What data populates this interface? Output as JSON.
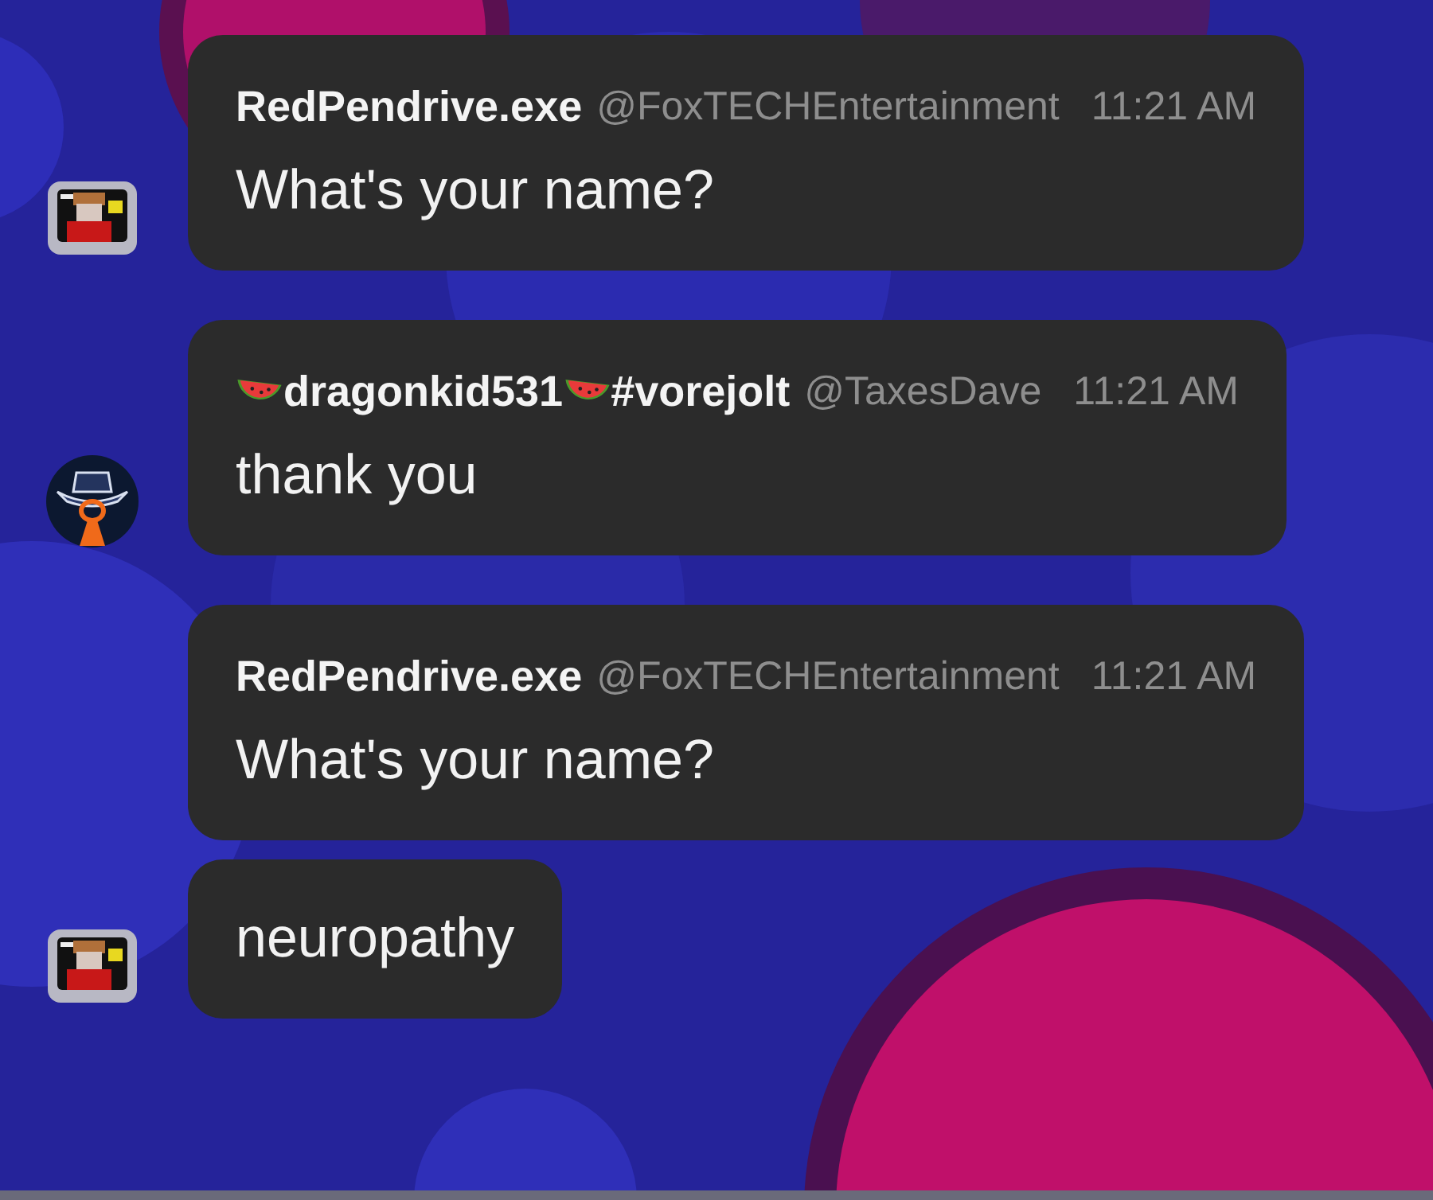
{
  "groups": [
    {
      "avatar": {
        "kind": "monitor"
      },
      "messages": [
        {
          "author_parts": [
            {
              "kind": "text",
              "text": "RedPendrive.exe"
            }
          ],
          "handle": "@FoxTECHEntertainment",
          "time": "11:21 AM",
          "text": "What's your name?"
        }
      ]
    },
    {
      "avatar": {
        "kind": "hat"
      },
      "messages": [
        {
          "author_parts": [
            {
              "kind": "watermelon"
            },
            {
              "kind": "text",
              "text": "dragonkid531"
            },
            {
              "kind": "watermelon"
            },
            {
              "kind": "text",
              "text": "#vorejolt"
            }
          ],
          "handle": "@TaxesDave",
          "time": "11:21 AM",
          "text": "thank you"
        }
      ]
    },
    {
      "avatar": {
        "kind": "monitor"
      },
      "messages": [
        {
          "author_parts": [
            {
              "kind": "text",
              "text": "RedPendrive.exe"
            }
          ],
          "handle": "@FoxTECHEntertainment",
          "time": "11:21 AM",
          "text": "What's your name?"
        },
        {
          "text": "neuropathy"
        }
      ]
    }
  ]
}
